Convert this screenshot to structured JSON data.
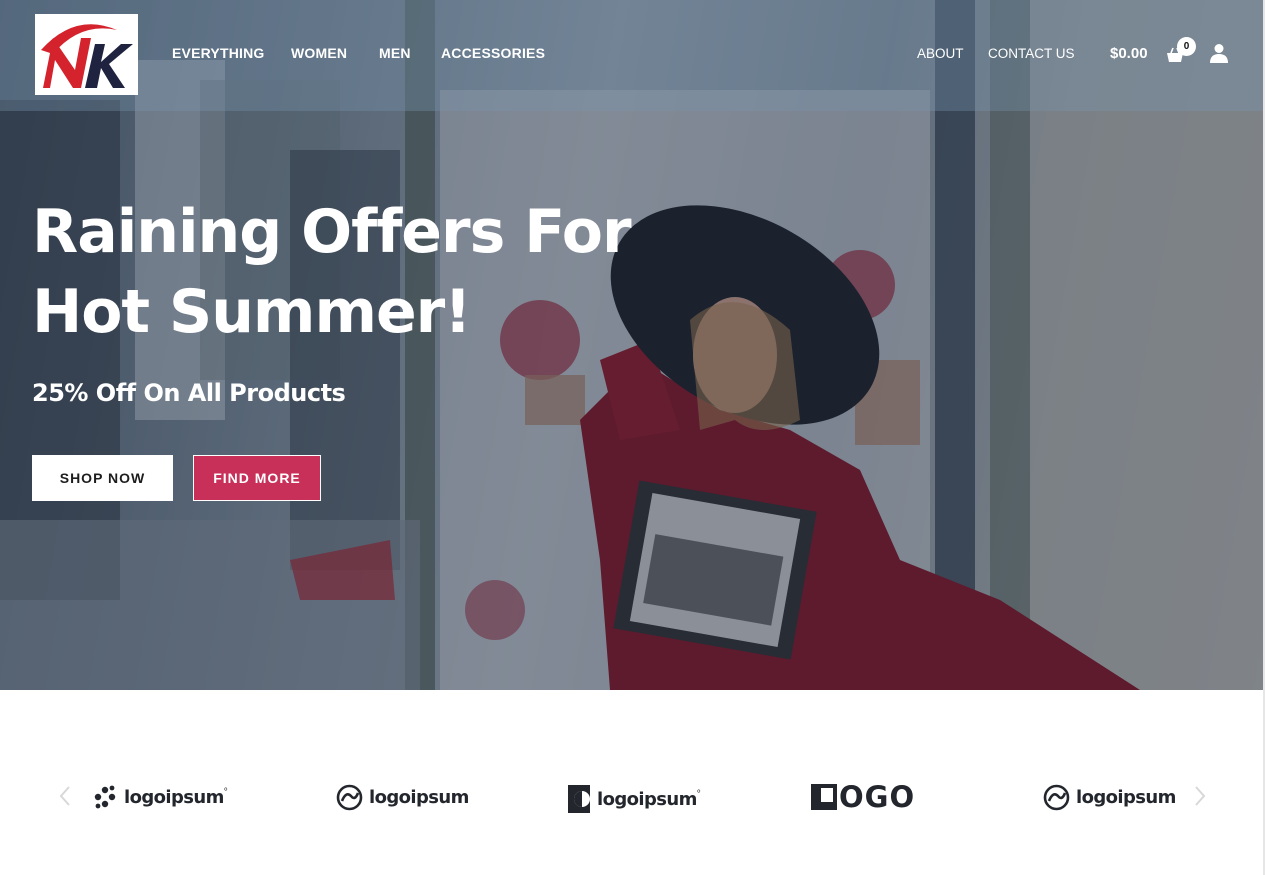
{
  "brand": {
    "logo_text": "NK"
  },
  "nav": {
    "primary": [
      {
        "label": "EVERYTHING"
      },
      {
        "label": "WOMEN"
      },
      {
        "label": "MEN"
      },
      {
        "label": "ACCESSORIES"
      }
    ],
    "secondary": [
      {
        "label": "ABOUT"
      },
      {
        "label": "CONTACT US"
      }
    ]
  },
  "cart": {
    "total": "$0.00",
    "count": "0"
  },
  "hero": {
    "title_line1": "Raining Offers For",
    "title_line2": "Hot Summer!",
    "subtitle": "25% Off On All Products",
    "shop_label": "SHOP NOW",
    "find_label": "FIND MORE"
  },
  "partners": [
    {
      "name": "logoipsum",
      "mark": "dots-mark-icon",
      "suffix": "°"
    },
    {
      "name": "logoipsum",
      "mark": "swirl-mark-icon",
      "suffix": ""
    },
    {
      "name": "logoipsum",
      "mark": "half-circle-mark-icon",
      "suffix": "°"
    },
    {
      "name": "OGO",
      "mark": "square-mark-icon",
      "suffix": ""
    },
    {
      "name": "logoipsum",
      "mark": "swirl-mark-icon",
      "suffix": ""
    }
  ],
  "colors": {
    "accent": "#c8305a",
    "text_dark": "#23272d",
    "overlay": "#1e2c40"
  }
}
